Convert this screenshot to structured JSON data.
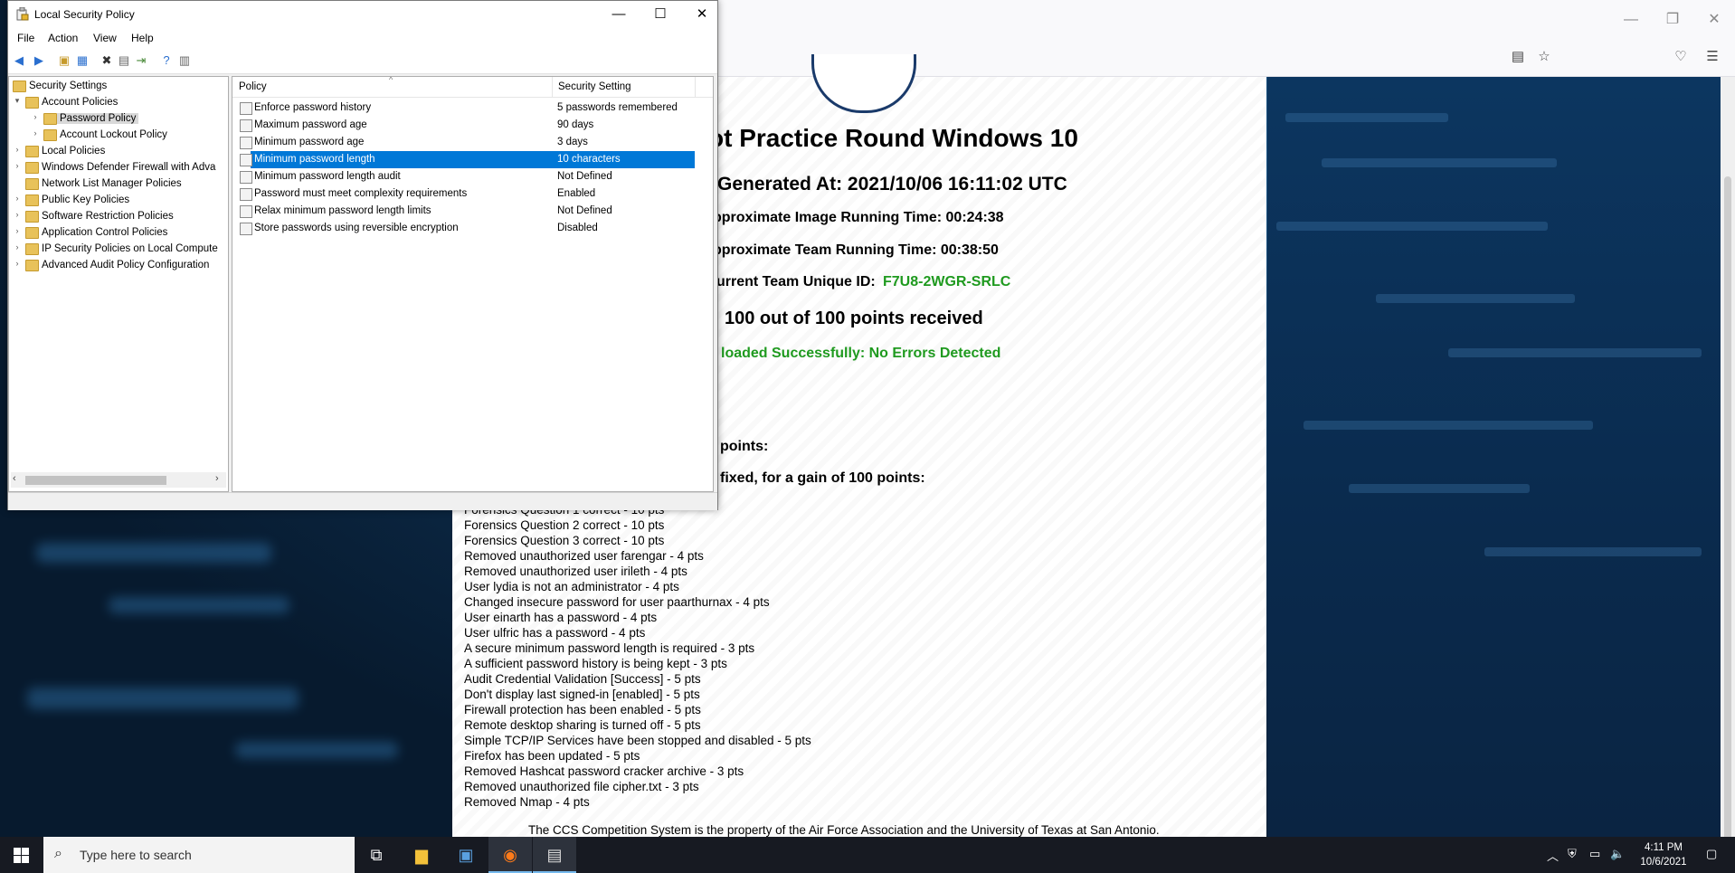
{
  "lsp": {
    "title": "Local Security Policy",
    "menu": [
      "File",
      "Action",
      "View",
      "Help"
    ],
    "tree": [
      {
        "label": "Security Settings",
        "depth": 0,
        "arrow": "",
        "selected": false
      },
      {
        "label": "Account Policies",
        "depth": 1,
        "arrow": "▾",
        "selected": false
      },
      {
        "label": "Password Policy",
        "depth": 2,
        "arrow": "›",
        "selected": true
      },
      {
        "label": "Account Lockout Policy",
        "depth": 2,
        "arrow": "›",
        "selected": false
      },
      {
        "label": "Local Policies",
        "depth": 1,
        "arrow": "›",
        "selected": false
      },
      {
        "label": "Windows Defender Firewall with Adva",
        "depth": 1,
        "arrow": "›",
        "selected": false
      },
      {
        "label": "Network List Manager Policies",
        "depth": 1,
        "arrow": "",
        "selected": false
      },
      {
        "label": "Public Key Policies",
        "depth": 1,
        "arrow": "›",
        "selected": false
      },
      {
        "label": "Software Restriction Policies",
        "depth": 1,
        "arrow": "›",
        "selected": false
      },
      {
        "label": "Application Control Policies",
        "depth": 1,
        "arrow": "›",
        "selected": false
      },
      {
        "label": "IP Security Policies on Local Compute",
        "depth": 1,
        "arrow": "›",
        "selected": false
      },
      {
        "label": "Advanced Audit Policy Configuration",
        "depth": 1,
        "arrow": "›",
        "selected": false
      }
    ],
    "columns": {
      "policy": "Policy",
      "setting": "Security Setting"
    },
    "rows": [
      {
        "policy": "Enforce password history",
        "setting": "5 passwords remembered",
        "selected": false
      },
      {
        "policy": "Maximum password age",
        "setting": "90 days",
        "selected": false
      },
      {
        "policy": "Minimum password age",
        "setting": "3 days",
        "selected": false
      },
      {
        "policy": "Minimum password length",
        "setting": "10 characters",
        "selected": true
      },
      {
        "policy": "Minimum password length audit",
        "setting": "Not Defined",
        "selected": false
      },
      {
        "policy": "Password must meet complexity requirements",
        "setting": "Enabled",
        "selected": false
      },
      {
        "policy": "Relax minimum password length limits",
        "setting": "Not Defined",
        "selected": false
      },
      {
        "policy": "Store passwords using reversible encryption",
        "setting": "Disabled",
        "selected": false
      }
    ]
  },
  "report": {
    "title": "triot Practice Round Windows 10",
    "generated": "Generated At: 2021/10/06 16:11:02 UTC",
    "image_time": "pproximate Image Running Time: 00:24:38",
    "team_time": "pproximate Team Running Time: 00:38:50",
    "team_id_label": "urrent Team Unique ID:",
    "team_id": "F7U8-2WGR-SRLC",
    "points": "100 out of 100 points received",
    "upload": "loaded Successfully: No Errors Detected",
    "penalties_heading": "points:",
    "fixed_heading": "fixed, for a gain of 100 points:",
    "items": [
      "Forensics Question 1 correct - 10 pts",
      "Forensics Question 2 correct - 10 pts",
      "Forensics Question 3 correct - 10 pts",
      "Removed unauthorized user farengar - 4 pts",
      "Removed unauthorized user irileth - 4 pts",
      "User lydia is not an administrator - 4 pts",
      "Changed insecure password for user paarthurnax - 4 pts",
      "User einarth has a password - 4 pts",
      "User ulfric has a password - 4 pts",
      "A secure minimum password length is required - 3 pts",
      "A sufficient password history is being kept - 3 pts",
      "Audit Credential Validation [Success] - 5 pts",
      "Don't display last signed-in [enabled] - 5 pts",
      "Firewall protection has been enabled - 5 pts",
      "Remote desktop sharing is turned off - 5 pts",
      "Simple TCP/IP Services have been stopped and disabled - 5 pts",
      "Firefox has been updated - 5 pts",
      "Removed Hashcat password cracker archive - 3 pts",
      "Removed unauthorized file cipher.txt - 3 pts",
      "Removed Nmap - 4 pts"
    ],
    "footer": "The CCS Competition System is the property of the Air Force Association and the University of Texas at San Antonio."
  },
  "taskbar": {
    "search_placeholder": "Type here to search",
    "time": "4:11 PM",
    "date": "10/6/2021"
  },
  "colors": {
    "accent": "#0078d7",
    "green": "#1f9a1f",
    "taskbar": "#171a22"
  }
}
